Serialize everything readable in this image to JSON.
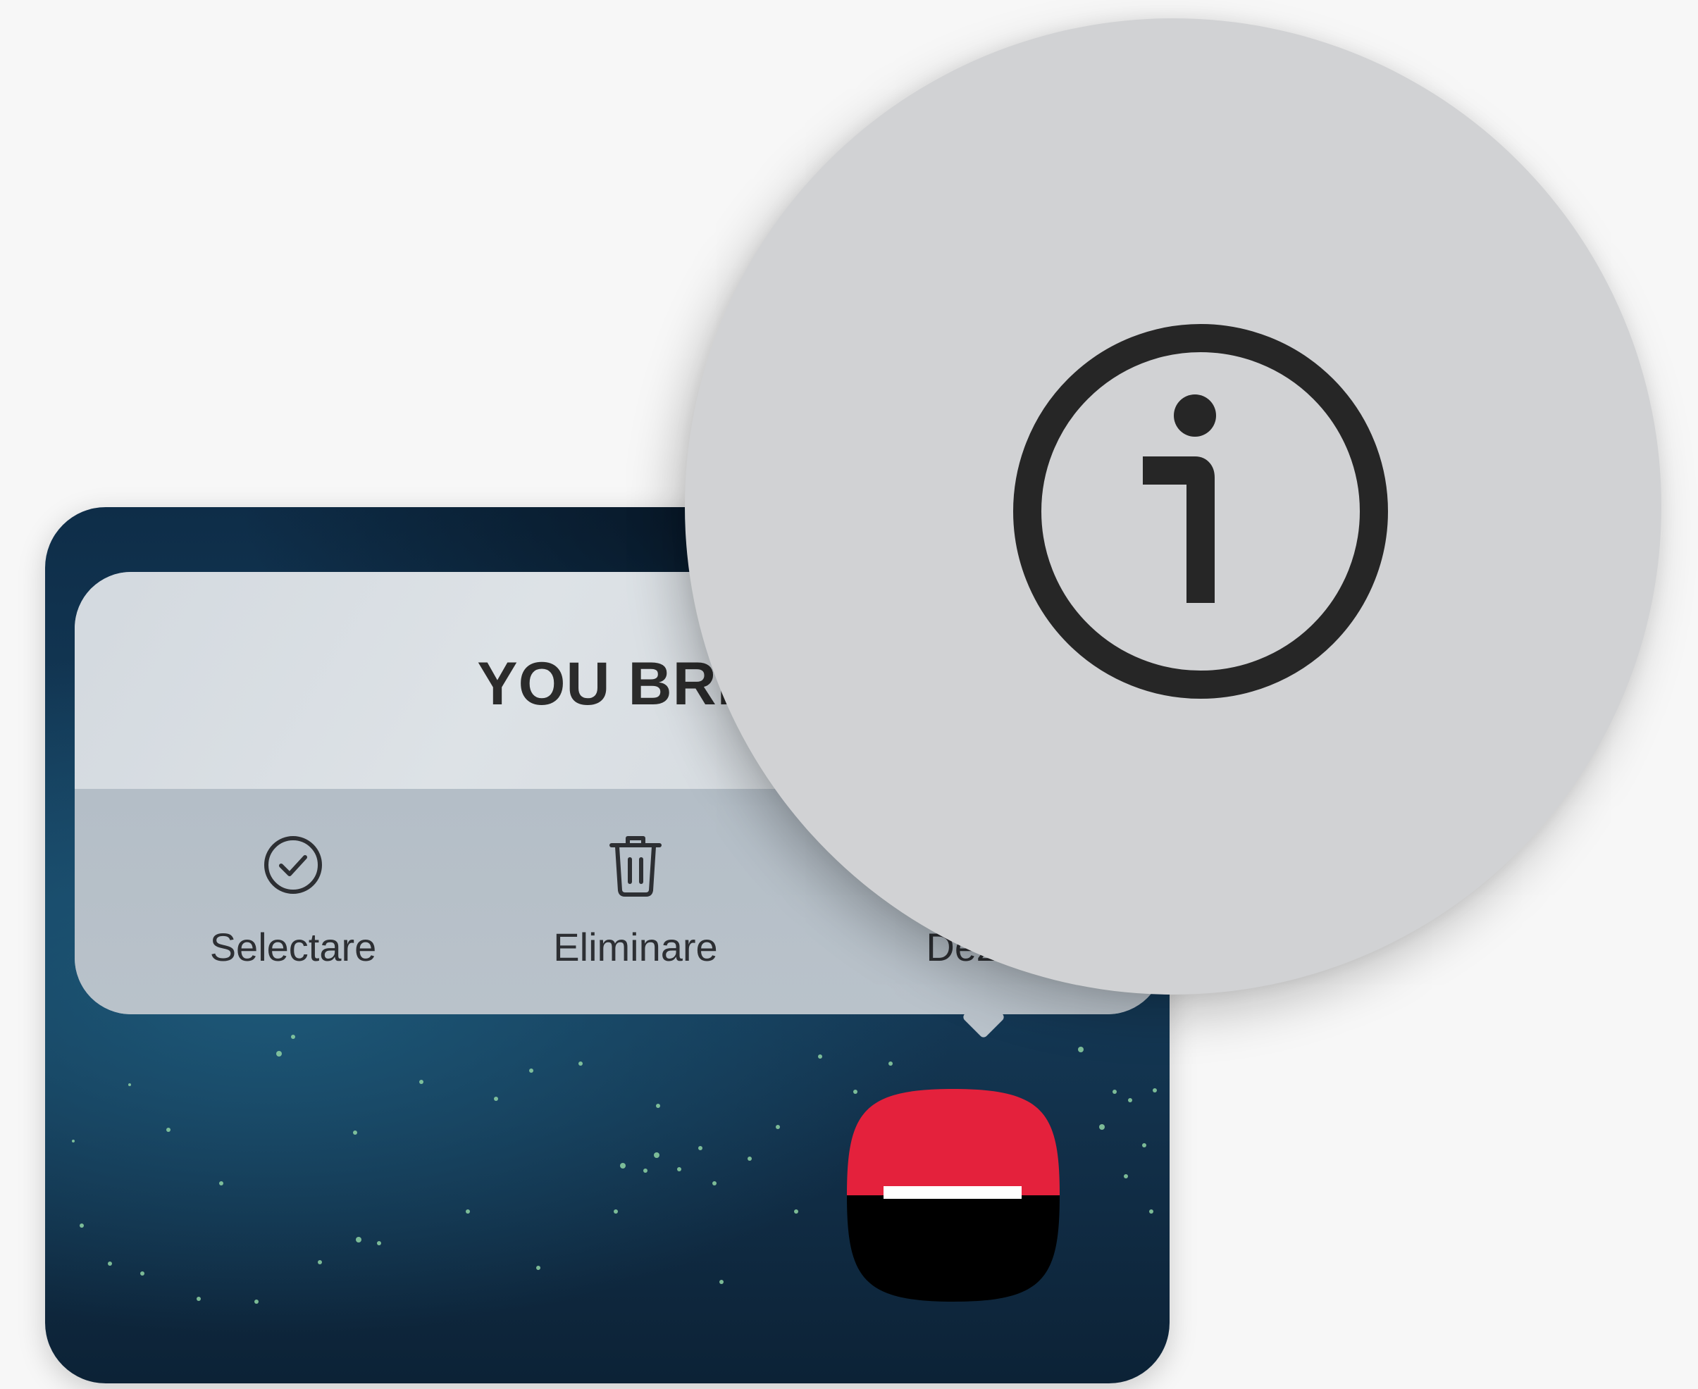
{
  "popup": {
    "title": "YOU BRD",
    "actions": [
      {
        "label": "Selectare",
        "icon": "check-circle-icon"
      },
      {
        "label": "Eliminare",
        "icon": "trash-icon"
      },
      {
        "label": "Dezin",
        "icon": "uninstall-icon"
      }
    ]
  },
  "magnifier": {
    "icon": "info-icon"
  },
  "app_icon": {
    "icon": "brd-app-icon",
    "colors": {
      "top": "#e4213c",
      "bottom": "#000000",
      "stripe": "#ffffff"
    }
  },
  "colors": {
    "background": "#f7f7f7",
    "popup_text": "#2b2b2b",
    "magnifier": "#d1d2d4"
  }
}
